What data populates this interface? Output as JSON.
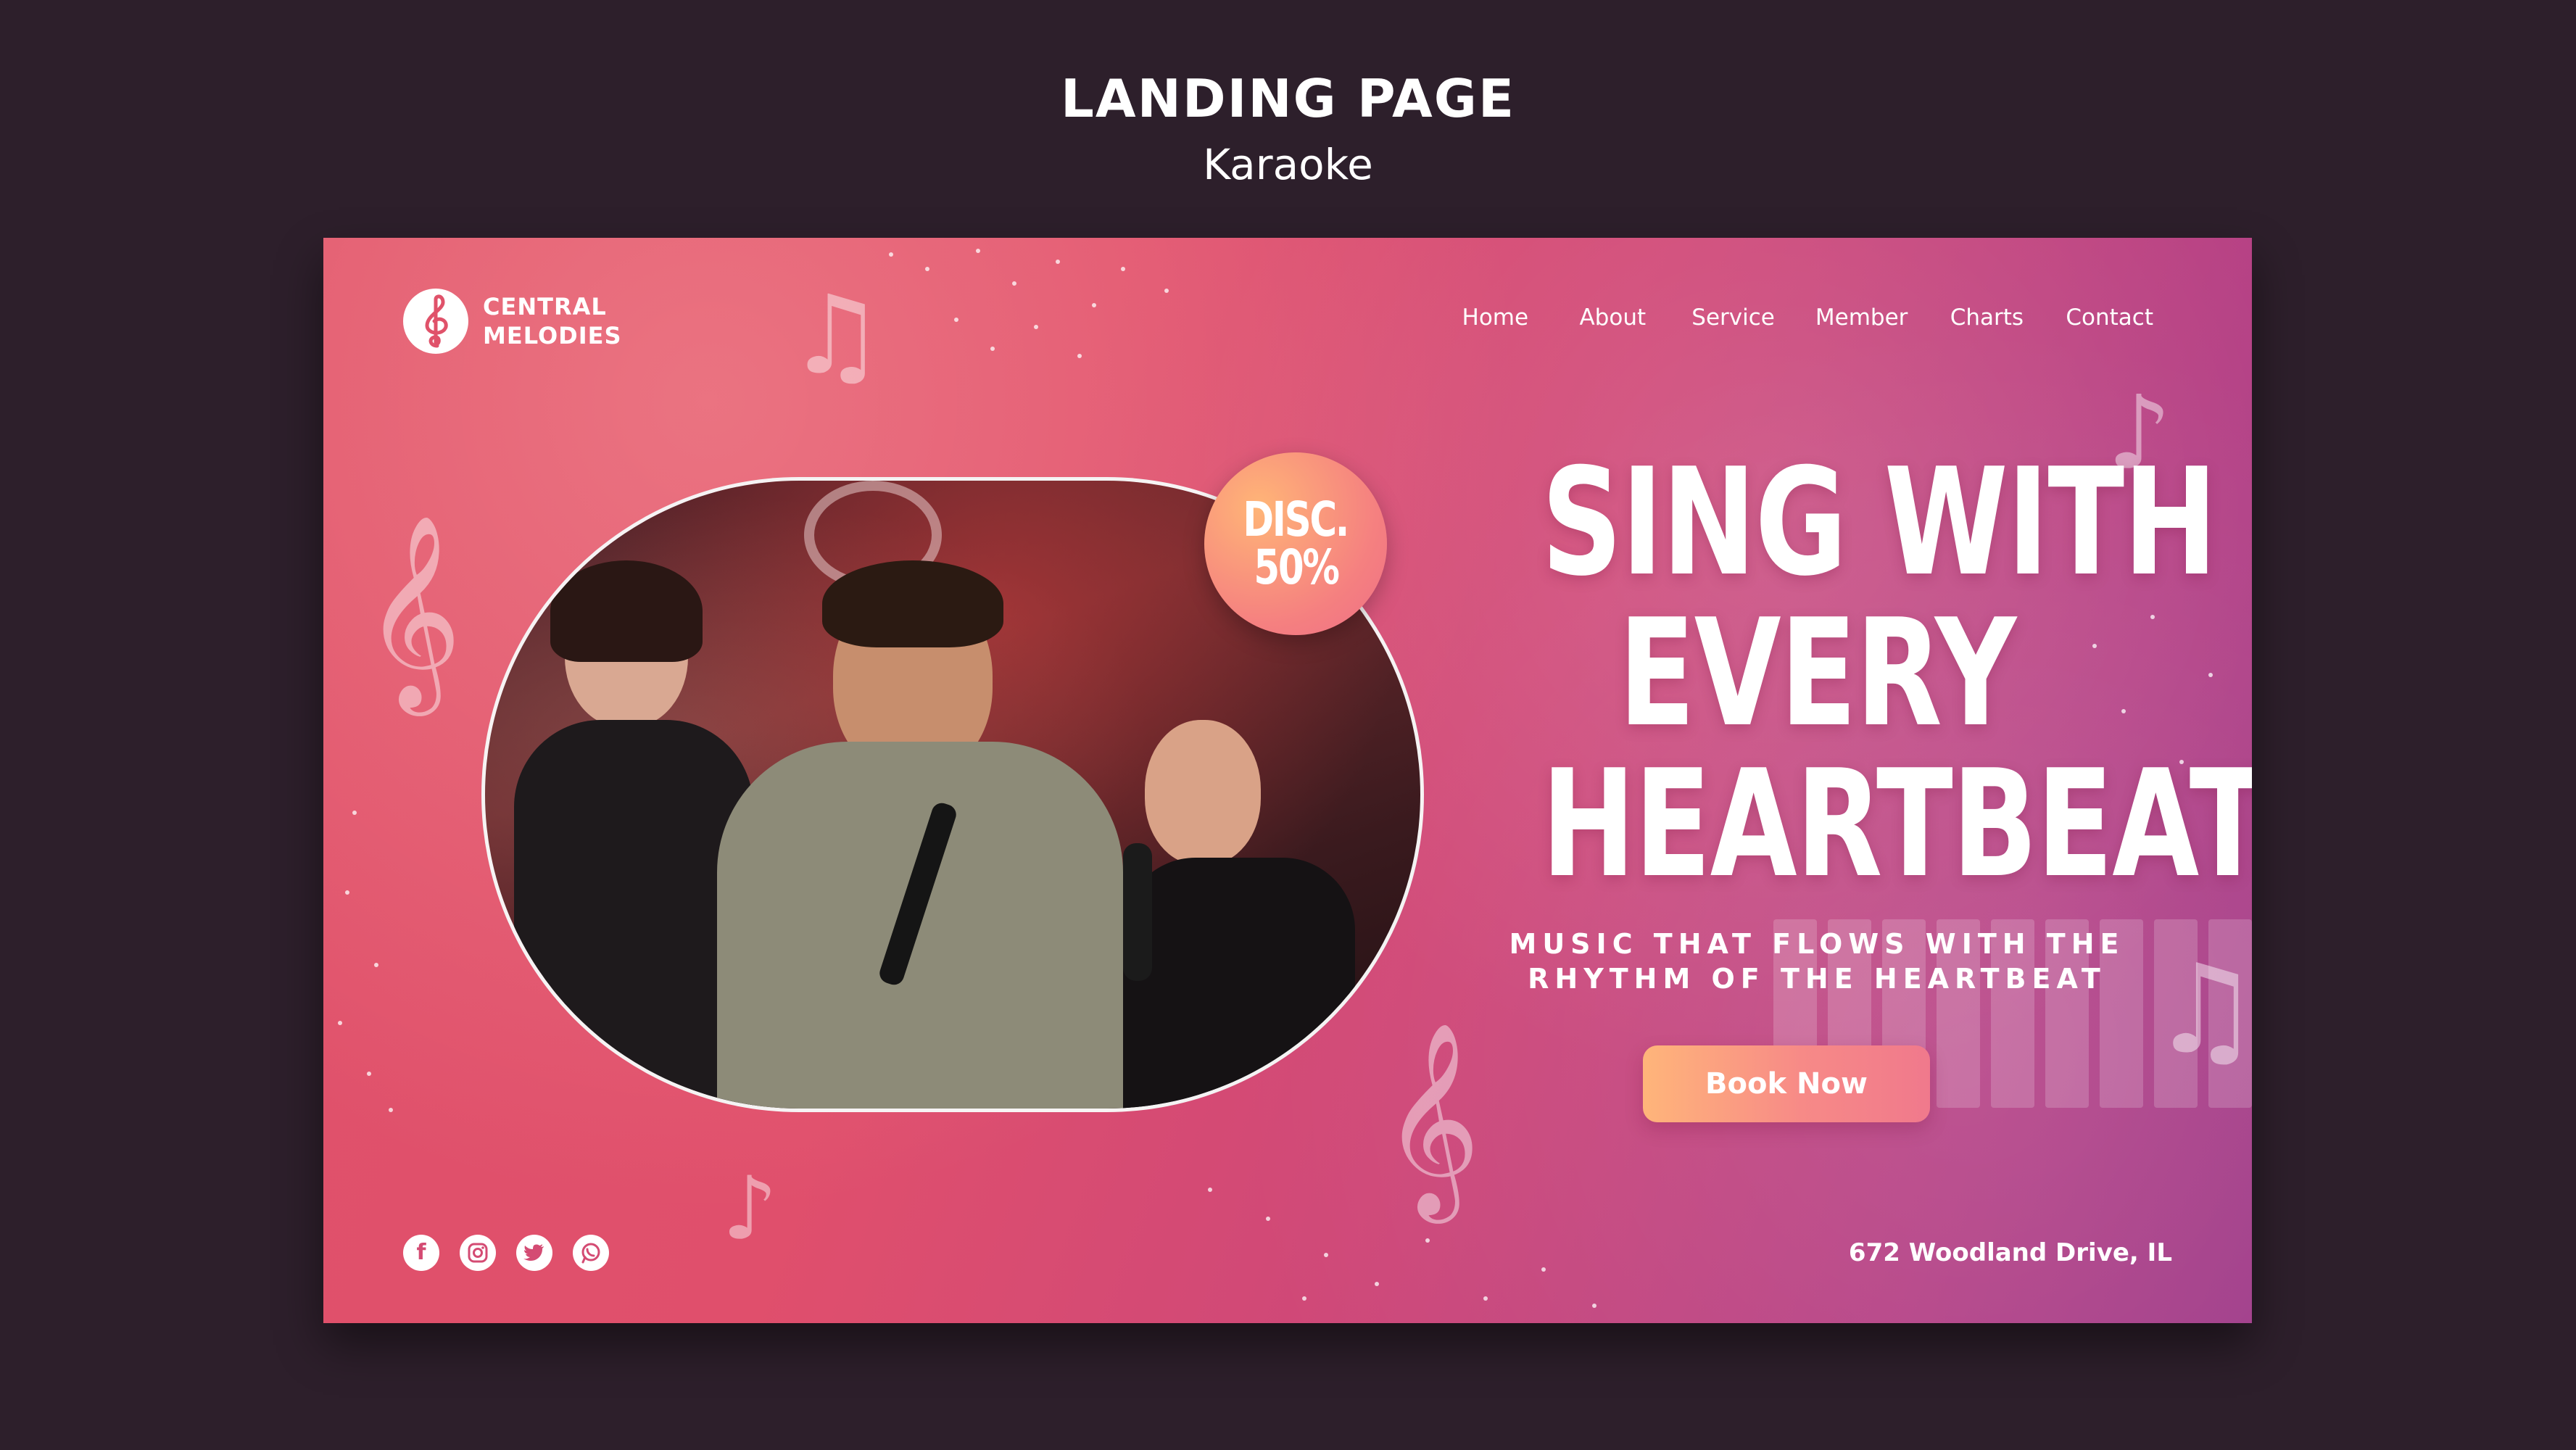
{
  "header": {
    "title": "LANDING PAGE",
    "subtitle": "Karaoke"
  },
  "brand": {
    "line1": "CENTRAL",
    "line2": "MELODIES",
    "logo_icon": "treble-clef-icon"
  },
  "nav": {
    "items": [
      {
        "label": "Home"
      },
      {
        "label": "About"
      },
      {
        "label": "Service"
      },
      {
        "label": "Member"
      },
      {
        "label": "Charts"
      },
      {
        "label": "Contact"
      }
    ]
  },
  "badge": {
    "line1": "DISC.",
    "line2": "50%"
  },
  "hero": {
    "headline": [
      "SING WITH",
      "EVERY",
      "HEARTBEAT"
    ],
    "tagline": [
      "MUSIC THAT FLOWS WITH THE",
      "RHYTHM OF THE HEARTBEAT"
    ],
    "cta_label": "Book Now"
  },
  "social": {
    "icons": [
      "facebook-icon",
      "instagram-icon",
      "twitter-icon",
      "whatsapp-icon"
    ]
  },
  "footer": {
    "address": "672 Woodland Drive, IL"
  },
  "colors": {
    "page_background": "#2d1f2b",
    "gradient_start": "#e0526a",
    "gradient_end": "#9f3a88",
    "button_start": "#ffb57a",
    "button_end": "#f0798c",
    "text": "#ffffff"
  }
}
